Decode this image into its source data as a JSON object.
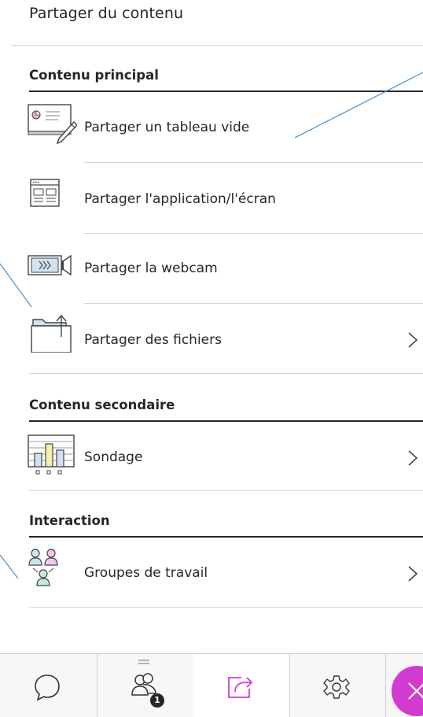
{
  "header": {
    "title": "Partager du contenu"
  },
  "sections": {
    "primary": {
      "title": "Contenu principal",
      "items": [
        {
          "label": "Partager un tableau vide",
          "icon": "whiteboard-icon"
        },
        {
          "label": "Partager l'application/l'écran",
          "icon": "application-window-icon"
        },
        {
          "label": "Partager la webcam",
          "icon": "webcam-icon"
        },
        {
          "label": "Partager des fichiers",
          "icon": "folder-upload-icon"
        }
      ]
    },
    "secondary": {
      "title": "Contenu secondaire",
      "items": [
        {
          "label": "Sondage",
          "icon": "poll-chart-icon"
        }
      ]
    },
    "interaction": {
      "title": "Interaction",
      "items": [
        {
          "label": "Groupes de travail",
          "icon": "breakout-groups-icon"
        }
      ]
    }
  },
  "bottom_bar": {
    "tabs": [
      "chat-icon",
      "attendees-icon",
      "share-content-icon",
      "settings-icon"
    ],
    "attendee_count": "1",
    "colors": {
      "accent": "#d33bd0",
      "callout_line": "#4a90c8"
    }
  }
}
